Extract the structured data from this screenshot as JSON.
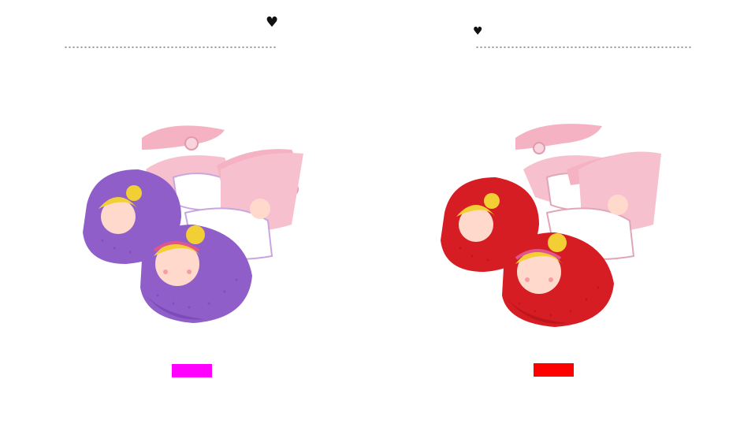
{
  "products": [
    {
      "id": "purple",
      "swatch_color": "#ff00ff",
      "toe_color": "#8f5ec9",
      "toe_shade": "#6f3fab",
      "strap_color": "#f7b9c8",
      "icons": {
        "heart": "heart-icon"
      }
    },
    {
      "id": "red",
      "swatch_color": "#ff0000",
      "toe_color": "#d61d23",
      "toe_shade": "#a9101a",
      "strap_color": "#f7b9c8",
      "icons": {
        "heart": "heart-icon"
      }
    }
  ]
}
